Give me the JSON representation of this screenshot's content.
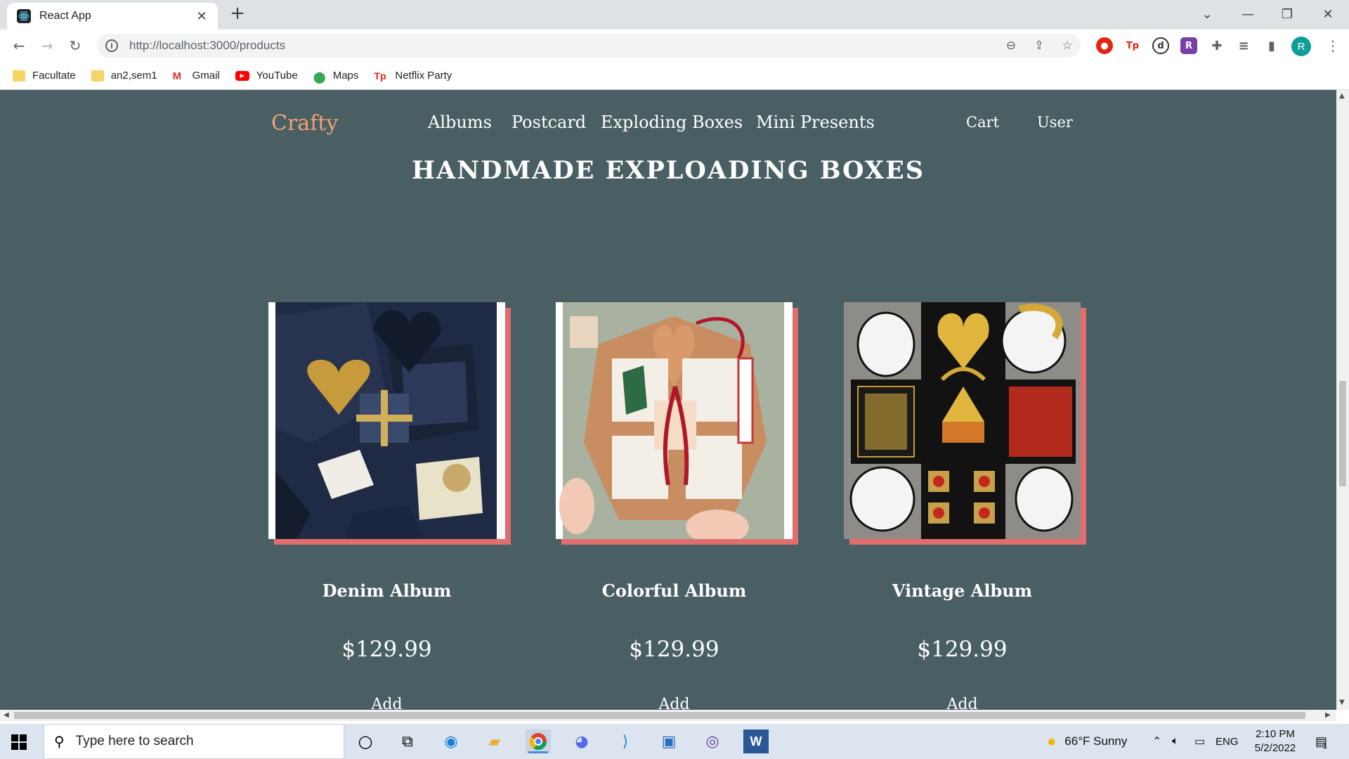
{
  "browser": {
    "tab_title": "React App",
    "tab_close": "✕",
    "new_tab": "+",
    "url": "http://localhost:3000/products",
    "profile_initial": "R",
    "window_controls": [
      "minimize",
      "restore",
      "close"
    ]
  },
  "bookmarks": [
    {
      "label": "Facultate",
      "icon": "folder-icon"
    },
    {
      "label": "an2,sem1",
      "icon": "folder-icon"
    },
    {
      "label": "Gmail",
      "icon": "gmail-icon"
    },
    {
      "label": "YouTube",
      "icon": "youtube-icon"
    },
    {
      "label": "Maps",
      "icon": "maps-icon"
    },
    {
      "label": "Netflix Party",
      "icon": "netflix-party-icon"
    }
  ],
  "site": {
    "logo": "Crafty",
    "menu": [
      "Albums",
      "Postcard",
      "Exploding Boxes",
      "Mini Presents"
    ],
    "cart": "Cart",
    "user": "User",
    "heading": "HANDMADE EXPLOADING BOXES",
    "colors": {
      "background": "#4a5f63",
      "accent": "#f2a279",
      "card_shadow": "#e06e6e"
    }
  },
  "products": [
    {
      "name": "Denim Album",
      "price": "$129.99",
      "add": "Add"
    },
    {
      "name": "Colorful Album",
      "price": "$129.99",
      "add": "Add"
    },
    {
      "name": "Vintage Album",
      "price": "$129.99",
      "add": "Add"
    }
  ],
  "taskbar": {
    "search_placeholder": "Type here to search",
    "weather": "66°F  Sunny",
    "language": "ENG",
    "time": "2:10 PM",
    "date": "5/2/2022",
    "notifications": "1"
  }
}
